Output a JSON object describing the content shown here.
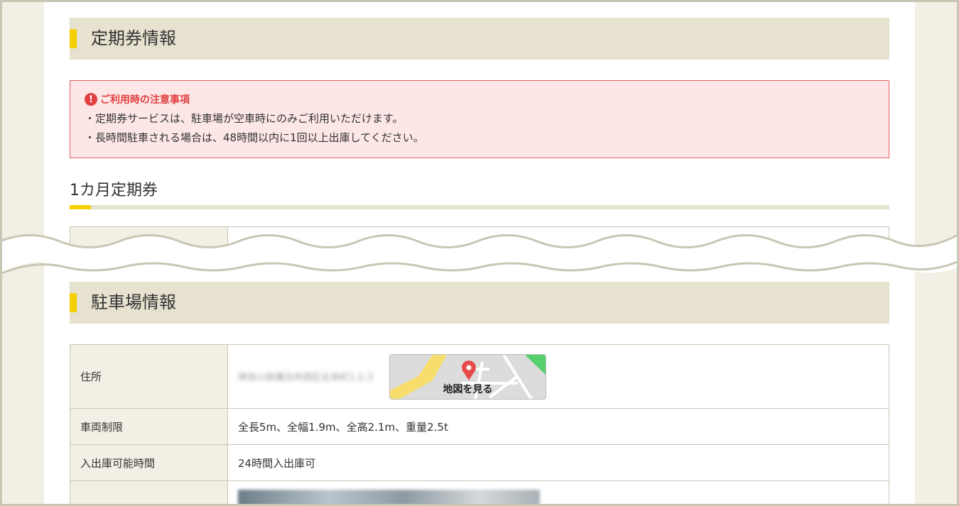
{
  "sections": {
    "pass_info": {
      "title": "定期券情報"
    },
    "parking_info": {
      "title": "駐車場情報"
    }
  },
  "notice": {
    "icon": "alert-circle-icon",
    "title": "ご利用時の注意事項",
    "lines": [
      "・定期券サービスは、駐車場が空車時にのみご利用いただけます。",
      "・長時間駐車される場合は、48時間以内に1回以上出庫してください。"
    ]
  },
  "monthly_pass": {
    "title": "1カ月定期券"
  },
  "parking_table": {
    "address": {
      "label": "住所",
      "value": "神奈川県横浜市西区北幸町1-2-3"
    },
    "map_button": {
      "label": "地図を見る"
    },
    "vehicle_limit": {
      "label": "車両制限",
      "value": "全長5m、全幅1.9m、全高2.1m、重量2.5t"
    },
    "hours": {
      "label": "入出庫可能時間",
      "value": "24時間入出庫可"
    }
  },
  "colors": {
    "accent": "#f5d000",
    "section_bg": "#e7e1cf",
    "notice_border": "#e06060",
    "notice_text": "#e04040"
  }
}
